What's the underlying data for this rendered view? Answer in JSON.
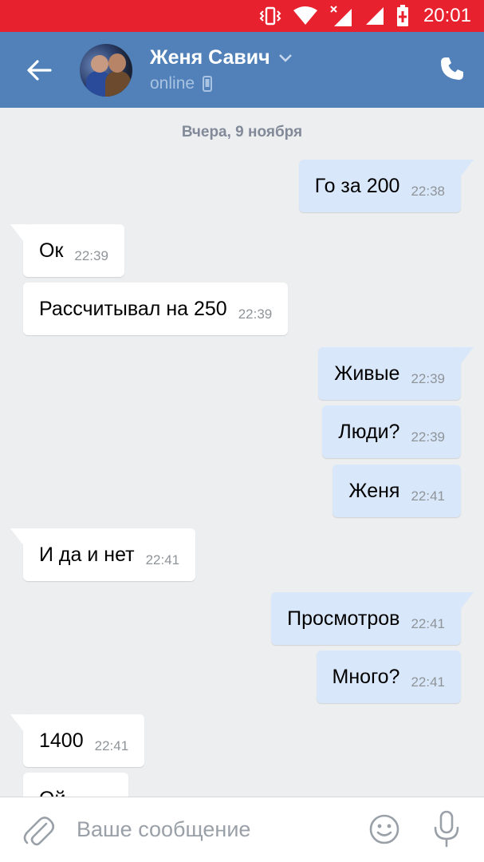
{
  "status_bar": {
    "time": "20:01",
    "icons": [
      "vibrate-icon",
      "wifi-icon",
      "no-signal-icon",
      "signal-icon",
      "battery-charging-icon"
    ]
  },
  "header": {
    "back_icon": "arrow-left-icon",
    "contact_name": "Женя Савич",
    "dropdown_icon": "chevron-down-icon",
    "status": "online",
    "status_icon": "mobile-icon",
    "call_icon": "phone-icon"
  },
  "chat": {
    "date_separator": "Вчера, 9 ноября",
    "messages": [
      {
        "direction": "out",
        "text": "Го за 200",
        "time": "22:38",
        "tail": true
      },
      {
        "direction": "in",
        "text": "Ок",
        "time": "22:39",
        "tail": true
      },
      {
        "direction": "in",
        "text": "Рассчитывал на 250",
        "time": "22:39",
        "tail": false
      },
      {
        "direction": "out",
        "text": "Живые",
        "time": "22:39",
        "tail": true
      },
      {
        "direction": "out",
        "text": "Люди?",
        "time": "22:39",
        "tail": false
      },
      {
        "direction": "out",
        "text": "Женя",
        "time": "22:41",
        "tail": false
      },
      {
        "direction": "in",
        "text": "И да и нет",
        "time": "22:41",
        "tail": true
      },
      {
        "direction": "out",
        "text": "Просмотров",
        "time": "22:41",
        "tail": true
      },
      {
        "direction": "out",
        "text": "Много?",
        "time": "22:41",
        "tail": false
      },
      {
        "direction": "in",
        "text": "1400",
        "time": "22:41",
        "tail": true
      },
      {
        "direction": "in",
        "text": "Ой",
        "time": "",
        "tail": false
      }
    ]
  },
  "composer": {
    "attach_icon": "paperclip-icon",
    "placeholder": "Ваше сообщение",
    "emoji_icon": "smiley-icon",
    "mic_icon": "microphone-icon"
  },
  "colors": {
    "status_bar": "#e8212e",
    "header": "#5181b8",
    "background": "#edeef0",
    "outgoing_bubble": "#d9e7fa",
    "incoming_bubble": "#ffffff"
  }
}
